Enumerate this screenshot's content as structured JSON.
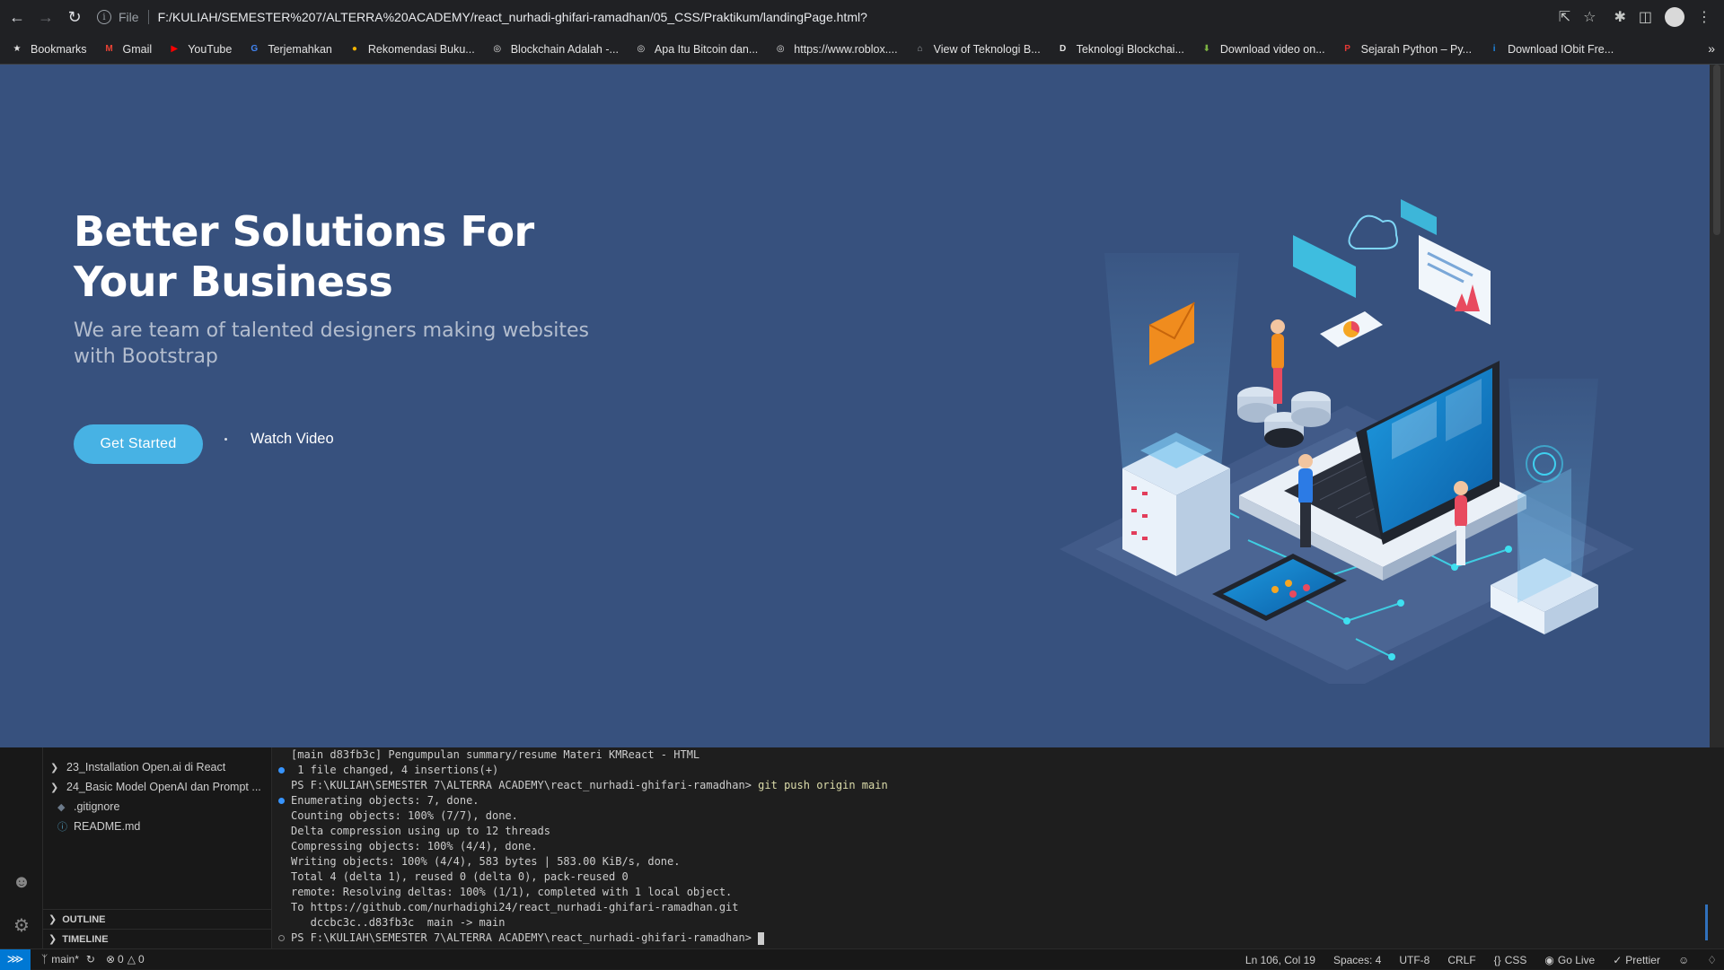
{
  "browser": {
    "url_scheme": "File",
    "url": "F:/KULIAH/SEMESTER%207/ALTERRA%20ACADEMY/react_nurhadi-ghifari-ramadhan/05_CSS/Praktikum/landingPage.html?"
  },
  "bookmarks": [
    {
      "label": "Bookmarks",
      "icon": "star-icon",
      "color": "#e3e3e3"
    },
    {
      "label": "Gmail",
      "icon": "gmail-icon",
      "color": "#ea4335"
    },
    {
      "label": "YouTube",
      "icon": "youtube-icon",
      "color": "#ff0000"
    },
    {
      "label": "Terjemahkan",
      "icon": "translate-icon",
      "color": "#4285f4"
    },
    {
      "label": "Rekomendasi Buku...",
      "icon": "book-icon",
      "color": "#f4b400"
    },
    {
      "label": "Blockchain Adalah -...",
      "icon": "globe-icon",
      "color": "#e3e3e3"
    },
    {
      "label": "Apa Itu Bitcoin dan...",
      "icon": "globe-icon",
      "color": "#e3e3e3"
    },
    {
      "label": "https://www.roblox....",
      "icon": "globe-icon",
      "color": "#e3e3e3"
    },
    {
      "label": "View of Teknologi B...",
      "icon": "journal-icon",
      "color": "#9aa0a6"
    },
    {
      "label": "Teknologi Blockchai...",
      "icon": "d-icon",
      "color": "#e3e3e3"
    },
    {
      "label": "Download video on...",
      "icon": "download-icon",
      "color": "#7cb342"
    },
    {
      "label": "Sejarah Python – Py...",
      "icon": "python-icon",
      "color": "#e53935"
    },
    {
      "label": "Download IObit Fre...",
      "icon": "iobit-icon",
      "color": "#1e88e5"
    }
  ],
  "hero": {
    "title": "Better Solutions For Your Business",
    "subtitle": "We are team of talented designers making websites with Bootstrap",
    "cta_primary": "Get Started",
    "cta_secondary": "Watch Video"
  },
  "explorer": {
    "items": [
      {
        "label": "23_Installation Open.ai di React",
        "type": "folder"
      },
      {
        "label": "24_Basic Model OpenAI dan Prompt ...",
        "type": "folder"
      },
      {
        "label": ".gitignore",
        "type": "file"
      },
      {
        "label": "README.md",
        "type": "file"
      }
    ],
    "sections": [
      "OUTLINE",
      "TIMELINE"
    ]
  },
  "terminal": {
    "lines": [
      "[main d83fb3c] Pengumpulan summary/resume Materi KMReact - HTML",
      " 1 file changed, 4 insertions(+)",
      "PS F:\\KULIAH\\SEMESTER 7\\ALTERRA ACADEMY\\react_nurhadi-ghifari-ramadhan> ",
      "Enumerating objects: 7, done.",
      "Counting objects: 100% (7/7), done.",
      "Delta compression using up to 12 threads",
      "Compressing objects: 100% (4/4), done.",
      "Writing objects: 100% (4/4), 583 bytes | 583.00 KiB/s, done.",
      "Total 4 (delta 1), reused 0 (delta 0), pack-reused 0",
      "remote: Resolving deltas: 100% (1/1), completed with 1 local object.",
      "To https://github.com/nurhadighi24/react_nurhadi-ghifari-ramadhan.git",
      "   dccbc3c..d83fb3c  main -> main",
      "PS F:\\KULIAH\\SEMESTER 7\\ALTERRA ACADEMY\\react_nurhadi-ghifari-ramadhan> "
    ],
    "command": "git push origin main"
  },
  "statusbar": {
    "branch": "main*",
    "errors": "0",
    "warnings": "0",
    "position": "Ln 106, Col 19",
    "spaces": "Spaces: 4",
    "encoding": "UTF-8",
    "eol": "CRLF",
    "language": "CSS",
    "golive": "Go Live",
    "prettier": "Prettier"
  },
  "colors": {
    "hero_bg": "#37517e",
    "accent": "#47b2e4",
    "vscode_remote": "#0078d4"
  }
}
